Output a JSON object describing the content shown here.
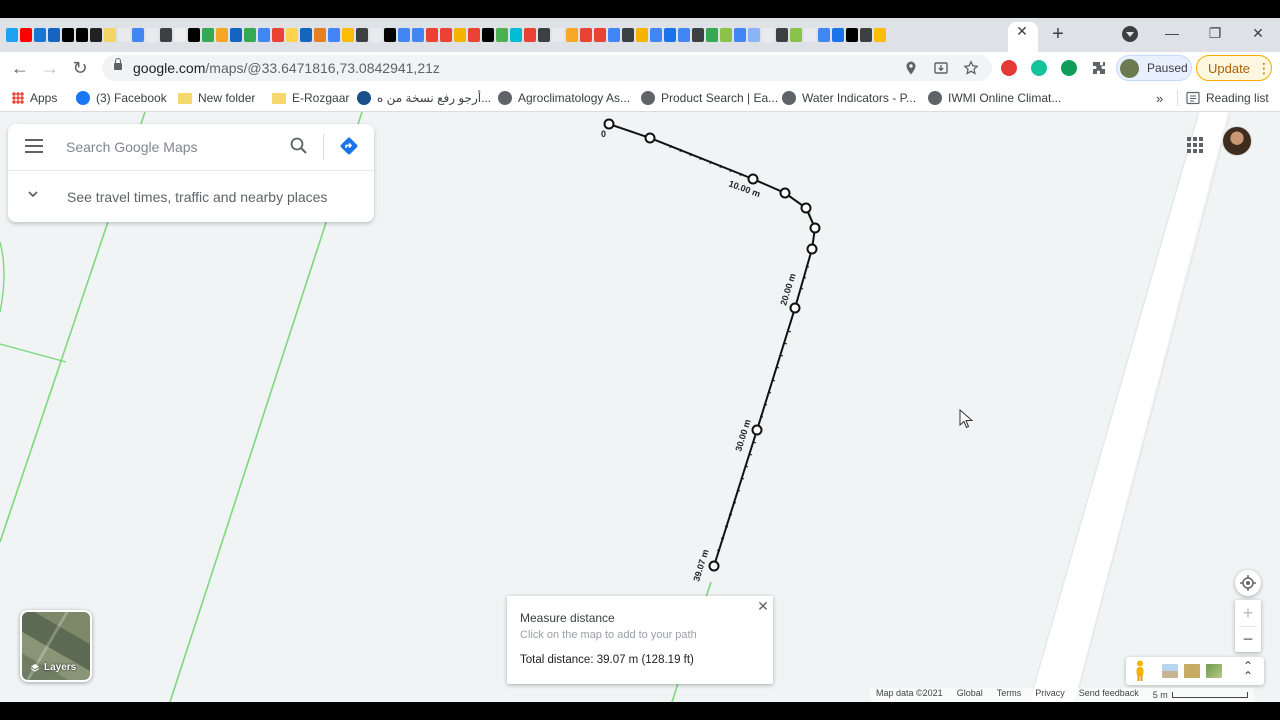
{
  "browser": {
    "tab_favicon_colors": [
      "#1da1f2",
      "#ff0000",
      "#1976d2",
      "#1565c0",
      "#000000",
      "#000000",
      "#222222",
      "#f6d365",
      "#e8eaed",
      "#4285f4",
      "#e8eaed",
      "#3c4043",
      "#eeeeee",
      "#000000",
      "#34a853",
      "#f5a623",
      "#1565c0",
      "#34a853",
      "#4285f4",
      "#ea4335",
      "#ffd54f",
      "#1565c0",
      "#e67e22",
      "#4285f4",
      "#fbbc05",
      "#3c4043",
      "#e8eaed",
      "#000000",
      "#4285f4",
      "#4285f4",
      "#ea4335",
      "#ea4335",
      "#f4b400",
      "#ea4335",
      "#000000",
      "#4caf50",
      "#00bcd4",
      "#ea4335",
      "#3c4043",
      "#e8eaed",
      "#f9a825",
      "#ea4335",
      "#ea4335",
      "#4285f4",
      "#3c4043",
      "#f4b400",
      "#4285f4",
      "#1a73e8",
      "#4285f4",
      "#3c4043",
      "#34a853",
      "#8bc34a",
      "#4285f4",
      "#8ab4f8",
      "#e8eaed",
      "#3c4043",
      "#8bc34a",
      "#e8eaed",
      "#4285f4",
      "#1a73e8",
      "#000000",
      "#3c4043",
      "#fbbc05"
    ],
    "active_tab_close": "✕",
    "new_tab": "+",
    "window_controls": {
      "minimize": "—",
      "restore": "❐",
      "close": "✕"
    },
    "url": {
      "host": "google.com",
      "path": "/maps/@33.6471816,73.0842941,21z"
    },
    "profile_label": "Paused",
    "update_label": "Update",
    "update_menu": "⋮",
    "bookmarks": [
      {
        "label": "Apps",
        "icon": "apps-grid-icon"
      },
      {
        "label": "(3) Facebook",
        "icon": "facebook-icon",
        "color": "#1877f2"
      },
      {
        "label": "New folder",
        "icon": "folder-icon"
      },
      {
        "label": "E-Rozgaar",
        "icon": "folder-icon"
      },
      {
        "label": "أرجو رفع نسخة من ه...",
        "icon": "dg-icon",
        "color": "#1a4f8a"
      },
      {
        "label": "Agroclimatology As...",
        "icon": "globe-icon",
        "color": "#5f6368"
      },
      {
        "label": "Product Search | Ea...",
        "icon": "globe-icon",
        "color": "#5f6368"
      },
      {
        "label": "Water Indicators - P...",
        "icon": "globe-icon",
        "color": "#5f6368"
      },
      {
        "label": "IWMI Online Climat...",
        "icon": "globe-icon",
        "color": "#5f6368"
      }
    ],
    "bookmarks_overflow": "»",
    "reading_list": "Reading list"
  },
  "maps": {
    "search_placeholder": "Search Google Maps",
    "travel_hint": "See travel times, traffic and nearby places",
    "measure": {
      "title": "Measure distance",
      "hint": "Click on the map to add to your path",
      "total": "Total distance: 39.07 m (128.19 ft)",
      "close": "✕"
    },
    "path_labels": [
      "0",
      "10.00 m",
      "20.00 m",
      "30.00 m",
      "39.07 m"
    ],
    "layers_label": "Layers",
    "zoom_in": "+",
    "zoom_out": "−",
    "footer": {
      "map_data": "Map data ©2021",
      "global": "Global",
      "terms": "Terms",
      "privacy": "Privacy",
      "feedback": "Send feedback",
      "scale": "5 m"
    },
    "colors": {
      "road_green": "#7dd87d",
      "map_bg": "#f1f4f4",
      "path": "#111111"
    }
  }
}
